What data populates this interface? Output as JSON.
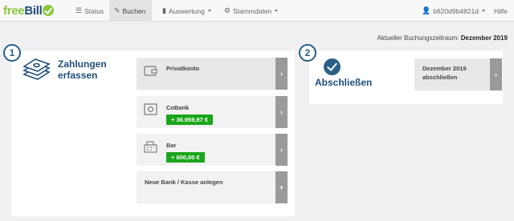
{
  "brand": {
    "part1": "free",
    "part2": "Bill"
  },
  "nav": {
    "status": "Status",
    "buchen": "Buchen",
    "auswertung": "Auswertung",
    "stammdaten": "Stammdaten",
    "user": "b620d9b4821d",
    "hilfe": "Hilfe"
  },
  "period": {
    "label": "Aktueller Buchungszeitraum:",
    "value": "Dezember 2019"
  },
  "steps": [
    "1",
    "2"
  ],
  "payments": {
    "title_line1": "Zahlungen",
    "title_line2": "erfassen",
    "accounts": [
      {
        "label": "Privatkonto",
        "badge": null,
        "icon": "wallet-icon"
      },
      {
        "label": "CoBank",
        "badge": "+ 36.959,97 €",
        "icon": "safe-icon"
      },
      {
        "label": "Bar",
        "badge": "+ 600,00 €",
        "icon": "cash-register-icon"
      }
    ],
    "new_account": "Neue Bank / Kasse anlegen",
    "arrow": "›",
    "plus": "+"
  },
  "closing": {
    "title": "Abschließen",
    "card_line1": "Dezember 2019",
    "card_line2": "abschließen"
  },
  "colors": {
    "brand_green": "#8cc63f",
    "brand_blue": "#1f4e79",
    "badge_green": "#1ba51b"
  }
}
